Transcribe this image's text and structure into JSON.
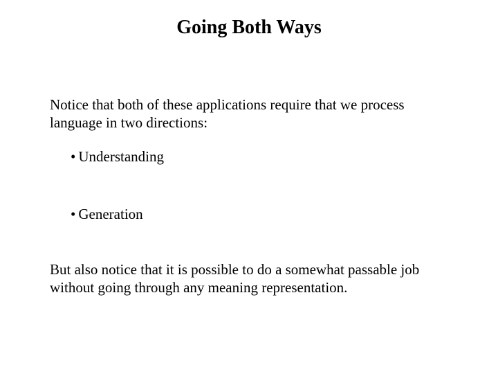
{
  "slide": {
    "title": "Going Both Ways",
    "intro": "Notice that both of these applications require that we process language in two directions:",
    "bullets": [
      {
        "text": "Understanding"
      },
      {
        "text": "Generation"
      }
    ],
    "closing": "But also notice that it is possible to do a somewhat passable job without going through any meaning representation."
  }
}
